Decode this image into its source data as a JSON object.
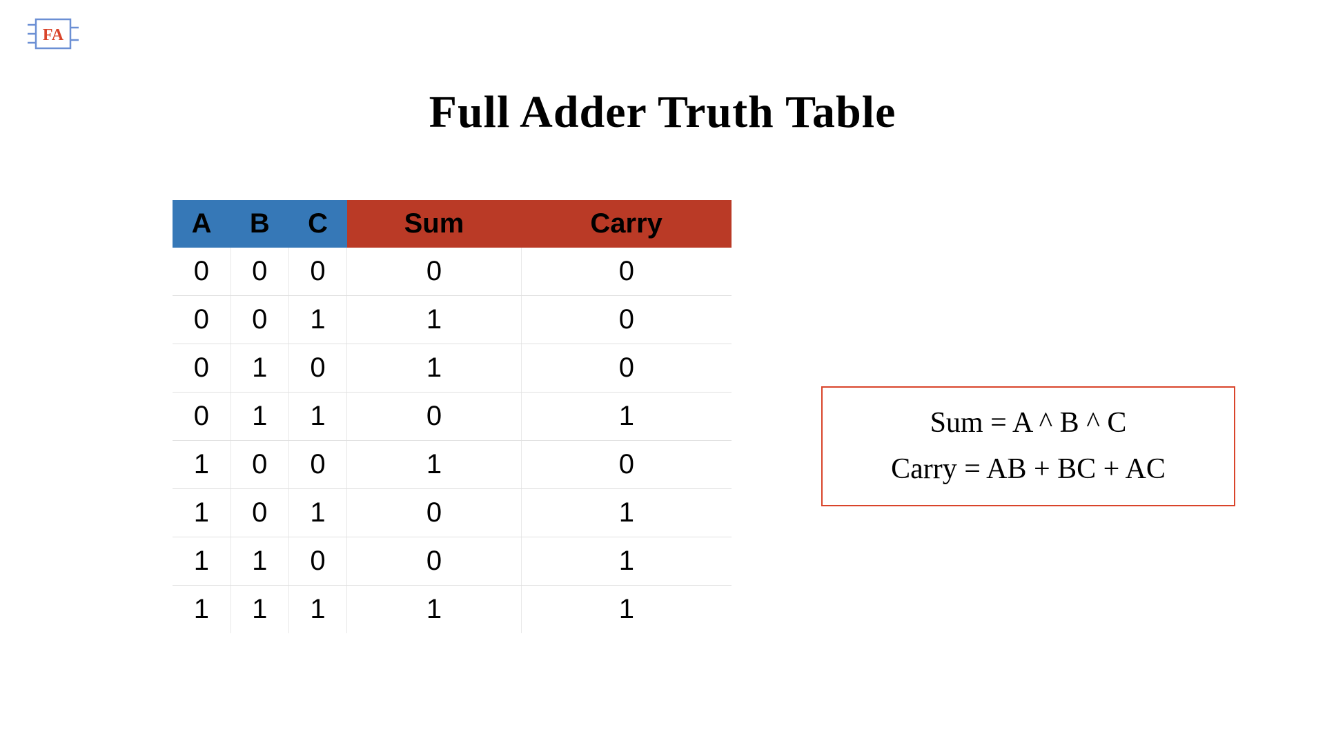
{
  "logo": {
    "text": "FA"
  },
  "title": "Full Adder Truth Table",
  "table": {
    "headers": {
      "inputs": [
        "A",
        "B",
        "C"
      ],
      "outputs": [
        "Sum",
        "Carry"
      ]
    },
    "rows": [
      {
        "A": "0",
        "B": "0",
        "C": "0",
        "Sum": "0",
        "Carry": "0"
      },
      {
        "A": "0",
        "B": "0",
        "C": "1",
        "Sum": "1",
        "Carry": "0"
      },
      {
        "A": "0",
        "B": "1",
        "C": "0",
        "Sum": "1",
        "Carry": "0"
      },
      {
        "A": "0",
        "B": "1",
        "C": "1",
        "Sum": "0",
        "Carry": "1"
      },
      {
        "A": "1",
        "B": "0",
        "C": "0",
        "Sum": "1",
        "Carry": "0"
      },
      {
        "A": "1",
        "B": "0",
        "C": "1",
        "Sum": "0",
        "Carry": "1"
      },
      {
        "A": "1",
        "B": "1",
        "C": "0",
        "Sum": "0",
        "Carry": "1"
      },
      {
        "A": "1",
        "B": "1",
        "C": "1",
        "Sum": "1",
        "Carry": "1"
      }
    ]
  },
  "formulas": {
    "sum": "Sum = A ^ B ^ C",
    "carry": "Carry = AB + BC + AC"
  },
  "colors": {
    "input_header": "#3678b7",
    "output_header": "#ba3a26",
    "formula_border": "#d9442a",
    "logo_border": "#6b8fd4",
    "logo_text": "#d9442a"
  }
}
